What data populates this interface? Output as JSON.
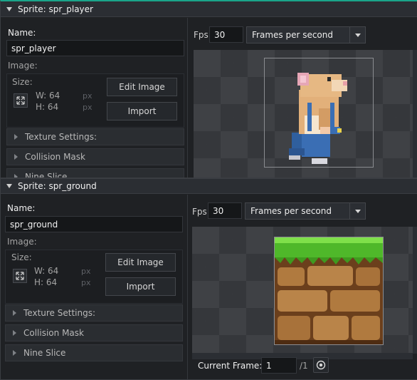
{
  "sprite_player": {
    "title": "Sprite: spr_player",
    "name_label": "Name:",
    "name_value": "spr_player",
    "image_label": "Image:",
    "size_label": "Size:",
    "width": "W: 64",
    "height": "H: 64",
    "unit": "px",
    "edit_image": "Edit Image",
    "import": "Import",
    "sections": [
      "Texture Settings:",
      "Collision Mask",
      "Nine Slice"
    ],
    "fps_label": "Fps",
    "fps_value": "30",
    "frames_mode": "Frames per second"
  },
  "sprite_ground": {
    "title": "Sprite: spr_ground",
    "name_label": "Name:",
    "name_value": "spr_ground",
    "image_label": "Image:",
    "size_label": "Size:",
    "width": "W: 64",
    "height": "H: 64",
    "unit": "px",
    "edit_image": "Edit Image",
    "import": "Import",
    "sections": [
      "Texture Settings:",
      "Collision Mask",
      "Nine Slice"
    ],
    "fps_label": "Fps",
    "fps_value": "30",
    "frames_mode": "Frames per second",
    "current_frame_label": "Current Frame:",
    "current_frame_value": "1",
    "frame_total": "/1"
  },
  "colors": {
    "accent_active_window": "#1aa58a",
    "panel_bg": "#1f2124",
    "checker_light": "#3f4145",
    "checker_dark": "#35373b"
  },
  "icons": {
    "resize": "resize-arrows-icon",
    "dropdown": "chevron-down-icon",
    "collapse": "collapse-triangle-icon",
    "section_expand": "chevron-right-icon",
    "onion": "onion-skin-icon"
  }
}
